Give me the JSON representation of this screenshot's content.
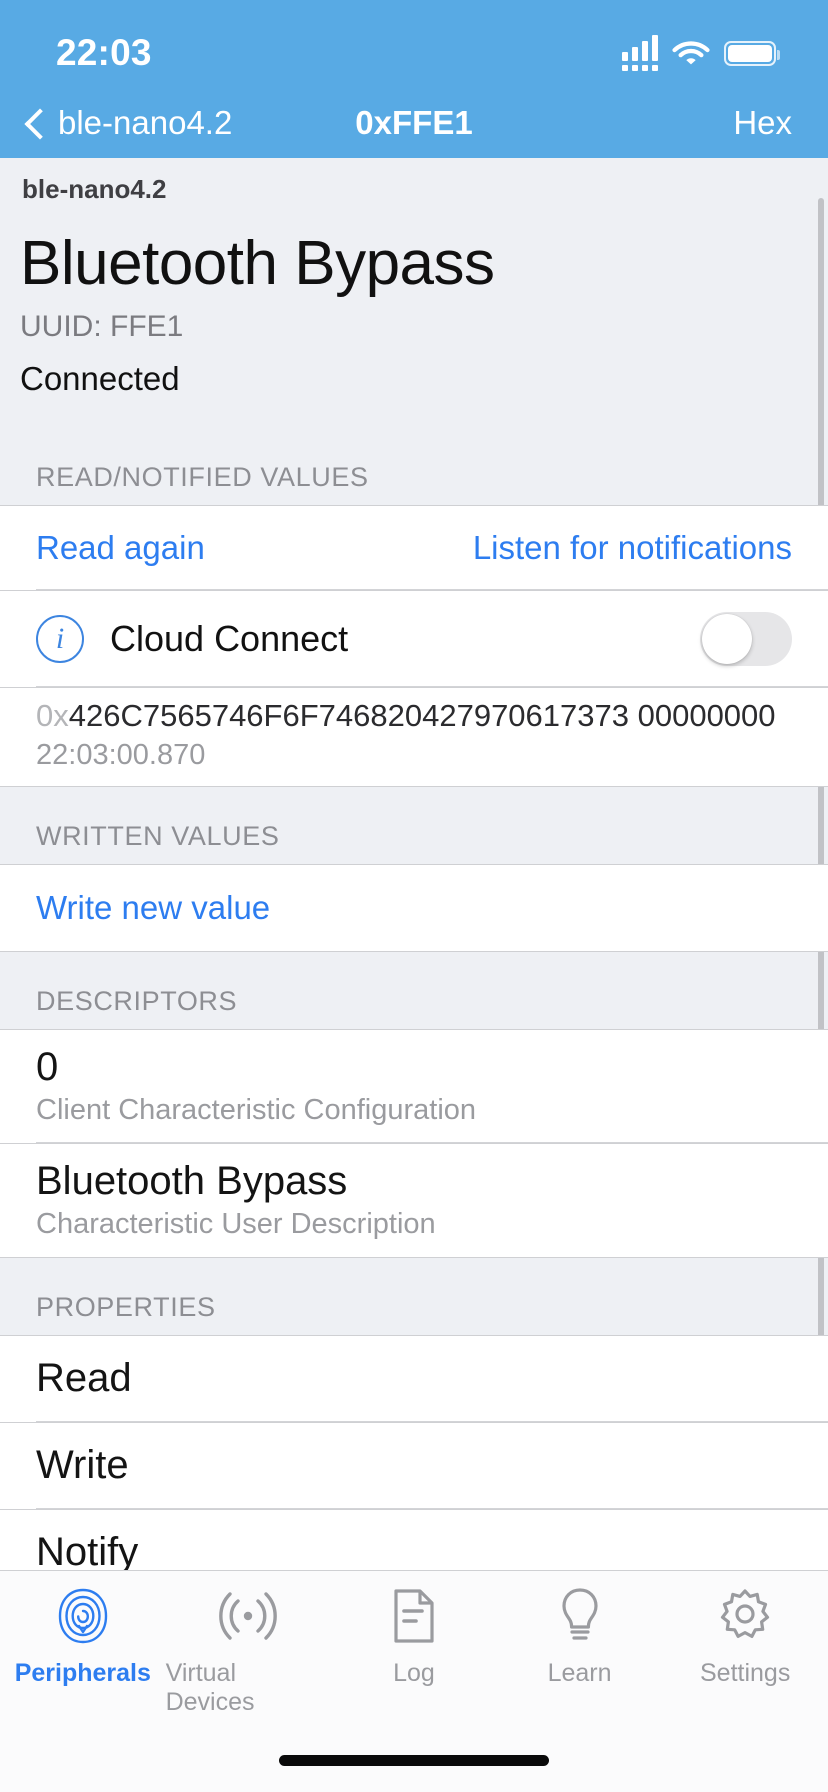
{
  "status_bar": {
    "time": "22:03",
    "cellular_icon": "cellular-signal-icon",
    "wifi_icon": "wifi-icon",
    "battery_icon": "battery-icon"
  },
  "nav_bar": {
    "back_icon": "chevron-left-icon",
    "back_label": "ble-nano4.2",
    "title": "0xFFE1",
    "right_action": "Hex"
  },
  "breadcrumb": "ble-nano4.2",
  "hero": {
    "title": "Bluetooth Bypass",
    "uuid": "UUID: FFE1",
    "connection_state": "Connected"
  },
  "read_section": {
    "header": "READ/NOTIFIED VALUES",
    "read_again": "Read again",
    "listen_notifications": "Listen for notifications",
    "toggle_row": {
      "info_icon": "info-circle-icon",
      "label": "Cloud Connect",
      "switch_state": "off"
    },
    "value": {
      "prefix": "0x",
      "hex": "426C7565746F6F746820427970617373 00000000",
      "timestamp": "22:03:00.870"
    }
  },
  "written_section": {
    "header": "WRITTEN VALUES",
    "write_new_value": "Write new value"
  },
  "descriptors_section": {
    "header": "DESCRIPTORS",
    "items": [
      {
        "value": "0",
        "name": "Client Characteristic Configuration"
      },
      {
        "value": "Bluetooth Bypass",
        "name": "Characteristic User Description"
      }
    ]
  },
  "properties_section": {
    "header": "PROPERTIES",
    "items": [
      "Read",
      "Write",
      "Notify"
    ]
  },
  "tab_bar": {
    "items": [
      {
        "label": "Peripherals",
        "icon": "fingerprint-icon",
        "active": true
      },
      {
        "label": "Virtual Devices",
        "icon": "broadcast-icon",
        "active": false
      },
      {
        "label": "Log",
        "icon": "document-lines-icon",
        "active": false
      },
      {
        "label": "Learn",
        "icon": "lightbulb-icon",
        "active": false
      },
      {
        "label": "Settings",
        "icon": "gear-icon",
        "active": false
      }
    ]
  },
  "colors": {
    "accent_blue": "#2d7df0",
    "nav_blue": "#58aae4",
    "group_bg": "#eef0f4",
    "muted_gray": "#9a9b9f"
  }
}
